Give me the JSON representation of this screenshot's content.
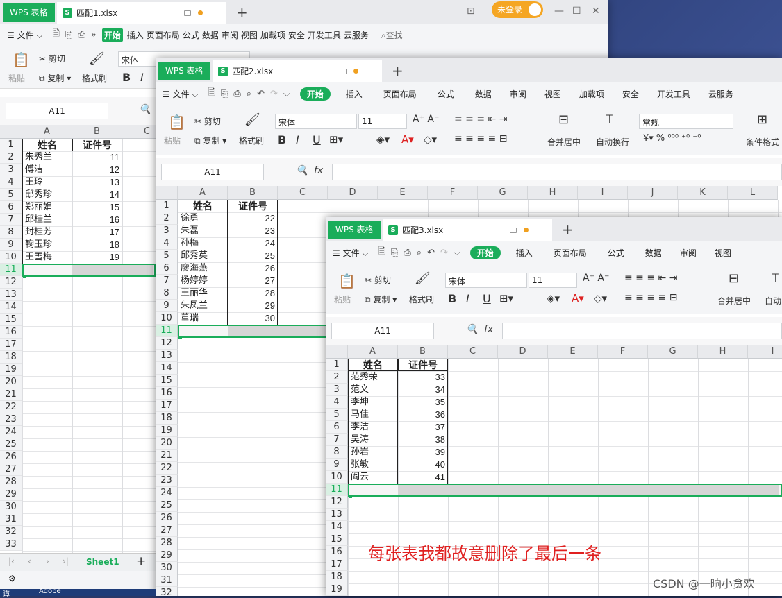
{
  "brand": "WPS 表格",
  "win1": {
    "tab": "匹配1.xlsx",
    "menu_file": "文件",
    "menu_tabs": [
      "开始",
      "插入",
      "页面布局",
      "公式",
      "数据",
      "审阅",
      "视图",
      "加载项",
      "安全",
      "开发工具",
      "云服务"
    ],
    "search": "查找",
    "login": "未登录",
    "namebox": "A11",
    "font": "宋体",
    "cols": [
      "A",
      "B",
      "C"
    ],
    "headers": [
      "姓名",
      "证件号"
    ],
    "names": [
      "朱秀兰",
      "傅洁",
      "王玲",
      "邸秀珍",
      "郑丽娟",
      "邱桂兰",
      "封桂芳",
      "鞠玉珍",
      "王雪梅"
    ],
    "ids": [
      "11",
      "12",
      "13",
      "14",
      "15",
      "16",
      "17",
      "18",
      "19"
    ],
    "rows": [
      "1",
      "2",
      "3",
      "4",
      "5",
      "6",
      "7",
      "8",
      "9",
      "10",
      "11",
      "12",
      "13",
      "14",
      "15",
      "16",
      "17",
      "18",
      "19",
      "20",
      "21",
      "22",
      "23",
      "24",
      "25",
      "26",
      "27",
      "28",
      "29",
      "30",
      "31",
      "32",
      "33"
    ],
    "sheet": "Sheet1",
    "ribbon": {
      "paste": "粘贴",
      "cut": "剪切",
      "copy": "复制",
      "brush": "格式刷"
    }
  },
  "win2": {
    "tab": "匹配2.xlsx",
    "menu_file": "文件",
    "menu_tabs": [
      "开始",
      "插入",
      "页面布局",
      "公式",
      "数据",
      "审阅",
      "视图",
      "加载项",
      "安全",
      "开发工具",
      "云服务"
    ],
    "namebox": "A11",
    "font": "宋体",
    "size": "11",
    "numfmt": "常规",
    "cols": [
      "A",
      "B",
      "C",
      "D",
      "E",
      "F",
      "G",
      "H",
      "I",
      "J",
      "K",
      "L"
    ],
    "headers": [
      "姓名",
      "证件号"
    ],
    "names": [
      "徐勇",
      "朱磊",
      "孙梅",
      "邱秀英",
      "廖海燕",
      "杨婷婷",
      "王丽华",
      "朱凤兰",
      "董瑞"
    ],
    "ids": [
      "22",
      "23",
      "24",
      "25",
      "26",
      "27",
      "28",
      "29",
      "30"
    ],
    "rows": [
      "1",
      "2",
      "3",
      "4",
      "5",
      "6",
      "7",
      "8",
      "9",
      "10",
      "11",
      "12",
      "13",
      "14",
      "15",
      "16",
      "17",
      "18",
      "19",
      "20",
      "21",
      "22",
      "23",
      "24",
      "25",
      "26",
      "27",
      "28",
      "29",
      "30",
      "31",
      "32"
    ],
    "ribbon": {
      "paste": "粘贴",
      "cut": "剪切",
      "copy": "复制",
      "brush": "格式刷",
      "merge": "合并居中",
      "wrap": "自动换行",
      "cond": "条件格式"
    }
  },
  "win3": {
    "tab": "匹配3.xlsx",
    "menu_file": "文件",
    "menu_tabs": [
      "开始",
      "插入",
      "页面布局",
      "公式",
      "数据",
      "审阅",
      "视图"
    ],
    "namebox": "A11",
    "font": "宋体",
    "size": "11",
    "cols": [
      "A",
      "B",
      "C",
      "D",
      "E",
      "F",
      "G",
      "H",
      "I"
    ],
    "headers": [
      "姓名",
      "证件号"
    ],
    "names": [
      "范秀荣",
      "范文",
      "李坤",
      "马佳",
      "李洁",
      "吴涛",
      "孙岩",
      "张敏",
      "阎云"
    ],
    "ids": [
      "33",
      "34",
      "35",
      "36",
      "37",
      "38",
      "39",
      "40",
      "41"
    ],
    "rows": [
      "1",
      "2",
      "3",
      "4",
      "5",
      "6",
      "7",
      "8",
      "9",
      "10",
      "11",
      "12",
      "13",
      "14",
      "15",
      "16",
      "17",
      "18",
      "19"
    ],
    "ribbon": {
      "paste": "粘贴",
      "cut": "剪切",
      "copy": "复制",
      "brush": "格式刷",
      "merge": "合并居中",
      "wrap": "自动"
    }
  },
  "annotation": "每张表我都故意删除了最后一条",
  "watermark": "CSDN @一晌小贪欢",
  "taskbar_left": "谭",
  "taskbar_app": "Adobe",
  "colors": {
    "accent": "#1aad5a",
    "annotation": "#e02020",
    "login": "#f5a623"
  }
}
